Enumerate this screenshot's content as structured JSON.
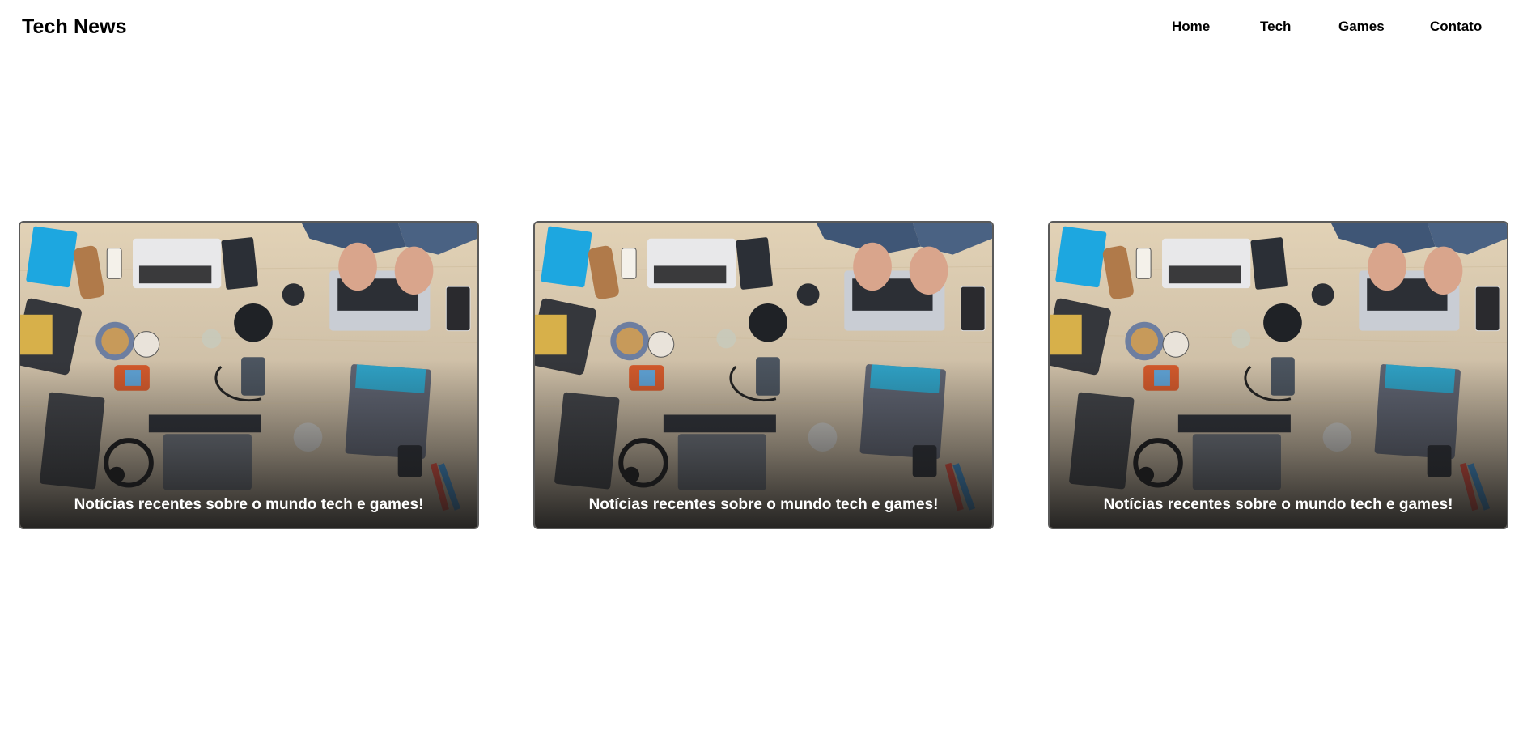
{
  "header": {
    "brand": "Tech News",
    "nav": [
      {
        "label": "Home"
      },
      {
        "label": "Tech"
      },
      {
        "label": "Games"
      },
      {
        "label": "Contato"
      }
    ]
  },
  "cards": [
    {
      "caption": "Notícias recentes sobre o mundo tech e games!",
      "image": "desk-with-laptops-photo"
    },
    {
      "caption": "Notícias recentes sobre o mundo tech e games!",
      "image": "desk-with-laptops-photo"
    },
    {
      "caption": "Notícias recentes sobre o mundo tech e games!",
      "image": "desk-with-laptops-photo"
    }
  ]
}
